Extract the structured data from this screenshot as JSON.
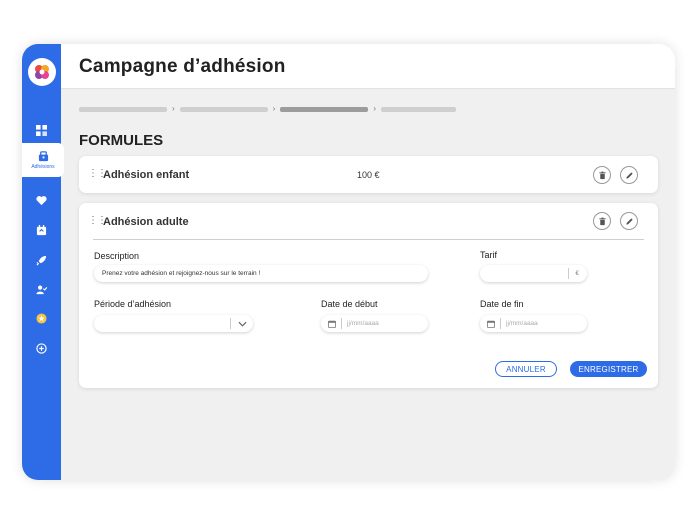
{
  "header": {
    "title": "Campagne d’adhésion"
  },
  "sidebar": {
    "active_label": "Adhésions",
    "icons": [
      "dashboard-icon",
      "adhesions-icon",
      "heart-icon",
      "calendar-icon",
      "rocket-icon",
      "users-icon",
      "badge-icon",
      "plus-circle-icon"
    ]
  },
  "section": {
    "title": "FORMULES"
  },
  "formules": [
    {
      "name": "Adhésion enfant",
      "price": "100 €"
    },
    {
      "name": "Adhésion adulte"
    }
  ],
  "form": {
    "description_label": "Description",
    "description_value": "Prenez votre adhésion et rejoignez-nous sur le terrain !",
    "tarif_label": "Tarif",
    "tarif_currency": "€",
    "periode_label": "Période d’adhésion",
    "date_debut_label": "Date de début",
    "date_debut_placeholder": "jj/mm/aaaa",
    "date_fin_label": "Date de fin",
    "date_fin_placeholder": "jj/mm/aaaa"
  },
  "actions": {
    "cancel": "ANNULER",
    "save": "ENREGISTRER"
  },
  "colors": {
    "primary": "#2e6be6",
    "background": "#f0f0f0"
  }
}
